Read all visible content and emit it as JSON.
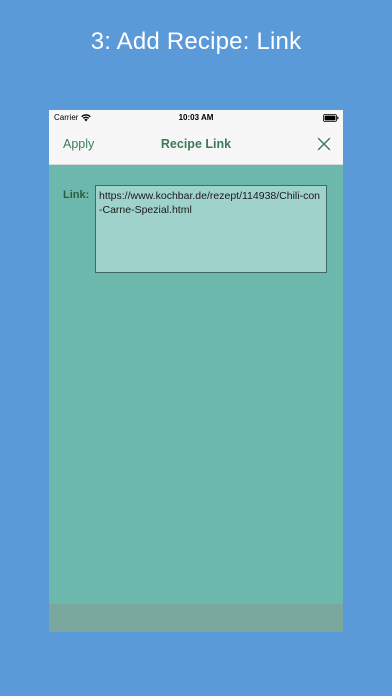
{
  "caption": "3: Add Recipe: Link",
  "statusbar": {
    "carrier": "Carrier",
    "time": "10:03 AM",
    "wifi_icon": "wifi-icon",
    "battery_icon": "battery-icon"
  },
  "navbar": {
    "apply_label": "Apply",
    "title": "Recipe Link",
    "close_icon": "close-icon"
  },
  "form": {
    "link_label": "Link:",
    "link_value": "https://www.kochbar.de/rezept/114938/Chili-con-Carne-Spezial.html"
  },
  "colors": {
    "background": "#5b9ad9",
    "content": "#6db8ac",
    "accent": "#3c7a5a",
    "field": "#9ed2cb"
  }
}
